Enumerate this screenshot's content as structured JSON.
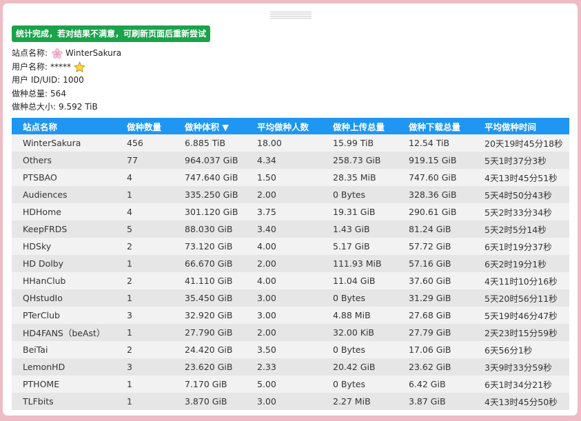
{
  "notice": "统计完成，若对结果不满意，可刷新页面后重新尝试",
  "info": {
    "site_label": "站点名称:",
    "site_value": "WinterSakura",
    "user_label": "用户名称:",
    "user_value": "*****",
    "uid_label": "用户 ID/UID:",
    "uid_value": "1000",
    "count_label": "做种总量:",
    "count_value": "564",
    "size_label": "做种总大小:",
    "size_value": "9.592 TiB"
  },
  "icons": {
    "site": "sakura-flower-icon",
    "user": "star-icon"
  },
  "colors": {
    "notice_bg": "#1aa34a",
    "header_bg": "#1e96f2",
    "page_bg": "#eebcc4"
  },
  "table": {
    "headers": [
      "站点名称",
      "做种数量",
      "做种体积 ▼",
      "平均做种人数",
      "做种上传总量",
      "做种下载总量",
      "平均做种时间"
    ],
    "rows": [
      [
        "WinterSakura",
        "456",
        "6.885 TiB",
        "18.00",
        "15.99 TiB",
        "12.54 TiB",
        "20天19时45分18秒"
      ],
      [
        "Others",
        "77",
        "964.037 GiB",
        "4.34",
        "258.73 GiB",
        "919.15 GiB",
        "5天1时37分3秒"
      ],
      [
        "PTSBAO",
        "4",
        "747.640 GiB",
        "1.50",
        "28.35 MiB",
        "747.60 GiB",
        "4天13时45分51秒"
      ],
      [
        "Audiences",
        "1",
        "335.250 GiB",
        "2.00",
        "0 Bytes",
        "328.36 GiB",
        "5天4时50分43秒"
      ],
      [
        "HDHome",
        "4",
        "301.120 GiB",
        "3.75",
        "19.31 GiB",
        "290.61 GiB",
        "5天2时33分34秒"
      ],
      [
        "KeepFRDS",
        "5",
        "88.030 GiB",
        "3.40",
        "1.43 GiB",
        "81.24 GiB",
        "5天2时5分14秒"
      ],
      [
        "HDSky",
        "2",
        "73.120 GiB",
        "4.00",
        "5.17 GiB",
        "57.72 GiB",
        "6天1时19分37秒"
      ],
      [
        "HD Dolby",
        "1",
        "66.670 GiB",
        "2.00",
        "111.93 MiB",
        "57.16 GiB",
        "6天2时19分1秒"
      ],
      [
        "HHanClub",
        "2",
        "41.110 GiB",
        "4.00",
        "11.04 GiB",
        "37.60 GiB",
        "4天11时10分16秒"
      ],
      [
        "QHstudIo",
        "1",
        "35.450 GiB",
        "3.00",
        "0 Bytes",
        "31.29 GiB",
        "5天20时56分11秒"
      ],
      [
        "PTerClub",
        "3",
        "32.920 GiB",
        "3.00",
        "4.88 MiB",
        "27.68 GiB",
        "5天19时46分47秒"
      ],
      [
        "HD4FANS（beAst）",
        "1",
        "27.790 GiB",
        "2.00",
        "32.00 KiB",
        "27.79 GiB",
        "2天23时15分59秒"
      ],
      [
        "BeiTai",
        "2",
        "24.420 GiB",
        "3.50",
        "0 Bytes",
        "17.06 GiB",
        "6天56分1秒"
      ],
      [
        "LemonHD",
        "3",
        "23.620 GiB",
        "2.33",
        "20.42 GiB",
        "23.62 GiB",
        "3天9时33分59秒"
      ],
      [
        "PTHOME",
        "1",
        "7.170 GiB",
        "5.00",
        "0 Bytes",
        "6.42 GiB",
        "6天1时34分21秒"
      ],
      [
        "TLFbits",
        "1",
        "3.870 GiB",
        "3.00",
        "2.27 MiB",
        "3.87 GiB",
        "4天13时45分50秒"
      ]
    ]
  }
}
